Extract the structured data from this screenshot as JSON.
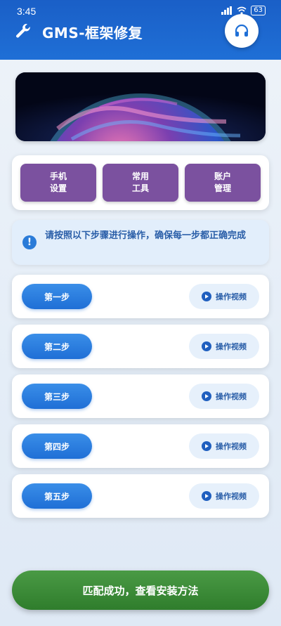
{
  "status": {
    "time": "3:45",
    "battery": "63",
    "icons": [
      "signal-icon",
      "wifi-icon",
      "battery-icon"
    ]
  },
  "header": {
    "title": "GMS-框架修复",
    "icon": "wrench-icon",
    "support_icon": "headset-icon",
    "color": "#1f6fd6"
  },
  "menu": [
    {
      "line1": "手机",
      "line2": "设置"
    },
    {
      "line1": "常用",
      "line2": "工具"
    },
    {
      "line1": "账户",
      "line2": "管理"
    }
  ],
  "notice": {
    "text": "请按照以下步骤进行操作，确保每一步都正确完成",
    "icon": "info-icon"
  },
  "steps": [
    {
      "label": "第一步",
      "video": "操作视频"
    },
    {
      "label": "第二步",
      "video": "操作视频"
    },
    {
      "label": "第三步",
      "video": "操作视频"
    },
    {
      "label": "第四步",
      "video": "操作视频"
    },
    {
      "label": "第五步",
      "video": "操作视频"
    }
  ],
  "bottom": {
    "label": "匹配成功，查看安装方法",
    "color": "#3a8a36"
  },
  "colors": {
    "accent": "#1f6fd6",
    "menu": "#7b519f",
    "success": "#3a8a36"
  }
}
